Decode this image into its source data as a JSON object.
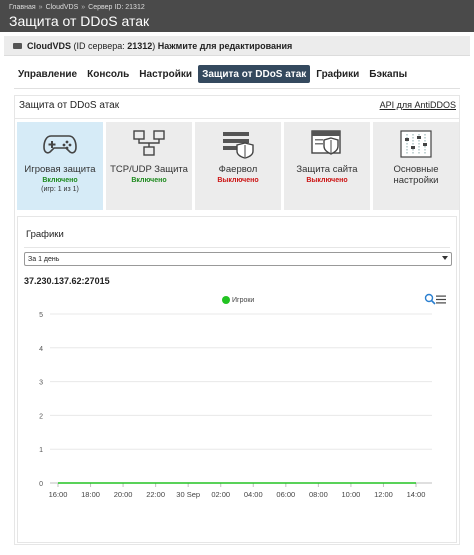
{
  "breadcrumb": {
    "items": [
      "Главная",
      "CloudVDS",
      "Сервер ID: 21312"
    ],
    "separator": "»"
  },
  "page_title": "Защита от DDoS атак",
  "server_bar": {
    "name": "CloudVDS",
    "id_prefix": "(ID сервера:",
    "id_value": "21312",
    "id_suffix": ")",
    "edit_label": "Нажмите для редактирования"
  },
  "tabs": [
    {
      "label": "Управление",
      "active": false
    },
    {
      "label": "Консоль",
      "active": false
    },
    {
      "label": "Настройки",
      "active": false
    },
    {
      "label": "Защита от DDoS атак",
      "active": true
    },
    {
      "label": "Графики",
      "active": false
    },
    {
      "label": "Бэкапы",
      "active": false
    }
  ],
  "panel": {
    "title": "Защита от DDoS атак",
    "api_link": "API для AntiDDOS"
  },
  "cards": [
    {
      "label": "Игровая защита",
      "status": "Включено",
      "note": "(игр: 1 из 1)",
      "icon": "gamepad-icon"
    },
    {
      "label": "TCP/UDP Защита",
      "status": "Включено",
      "icon": "network-icon"
    },
    {
      "label": "Фаервол",
      "status": "Выключено",
      "icon": "firewall-icon"
    },
    {
      "label": "Защита сайта",
      "status": "Выключено",
      "icon": "website-shield-icon"
    },
    {
      "label": "Основные",
      "label2": "настройки",
      "icon": "sliders-icon"
    }
  ],
  "graphs": {
    "title": "Графики",
    "period": "За 1 день",
    "ip": "37.230.137.62:27015"
  },
  "colors": {
    "header_bg": "#4a4a4a",
    "active_tab": "#34495e",
    "status_on": "#1e8a1e",
    "status_off": "#cc1111",
    "series": "#22c322",
    "active_card": "#d6ebf7"
  },
  "chart_data": {
    "type": "line",
    "series": [
      {
        "name": "Игроки",
        "values": [
          0,
          0,
          0,
          0,
          0,
          0,
          0,
          0,
          0,
          0,
          0,
          0
        ]
      }
    ],
    "x": [
      "16:00",
      "18:00",
      "20:00",
      "22:00",
      "30 Sep",
      "02:00",
      "04:00",
      "06:00",
      "08:00",
      "10:00",
      "12:00",
      "14:00"
    ],
    "yticks": [
      0,
      1,
      2,
      3,
      4,
      5
    ],
    "ylim": [
      0,
      5
    ],
    "grid": true,
    "legend": "top-center"
  }
}
